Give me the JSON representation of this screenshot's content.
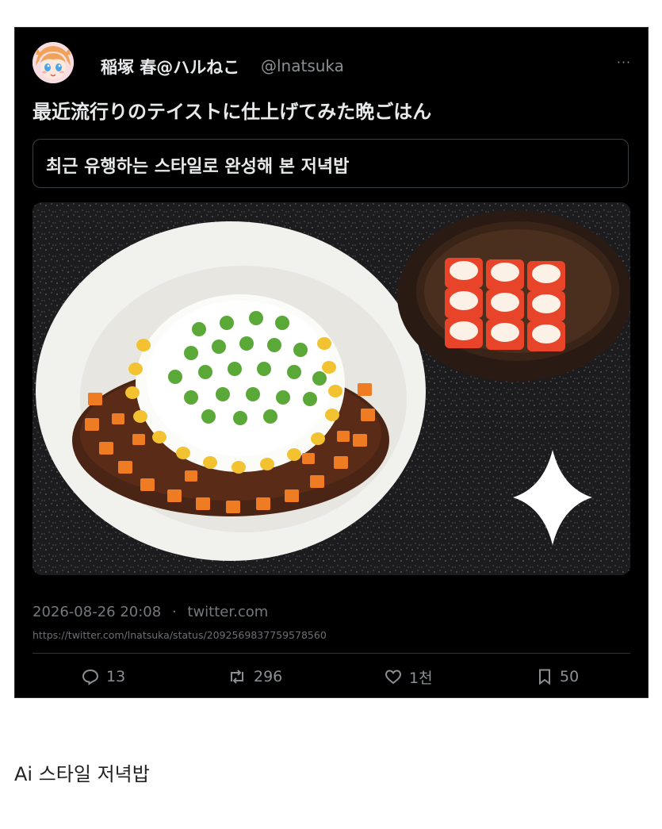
{
  "tweet": {
    "display_name": "稲塚 春@ハルねこ",
    "handle": "@lnatsuka",
    "more_label": "···",
    "text": "最近流行りのテイストに仕上げてみた晩ごはん",
    "translation": "최근 유행하는 스타일로 완성해 본 저녁밥",
    "timestamp": "2026-08-26 20:08",
    "separator": "·",
    "source": "twitter.com",
    "url": "https://twitter.com/lnatsuka/status/2092569837759578560",
    "actions": {
      "replies": "13",
      "retweets": "296",
      "likes": "1천",
      "bookmarks": "50"
    }
  },
  "caption": "Ai 스타일 저녁밥",
  "icons": [
    "avatar-image",
    "more-icon",
    "reply-icon",
    "retweet-icon",
    "like-icon",
    "bookmark-icon",
    "sparkle-icon"
  ],
  "colors": {
    "card_background": "#000000",
    "text_primary": "#e7e9ea",
    "text_secondary": "#8b8f94"
  }
}
